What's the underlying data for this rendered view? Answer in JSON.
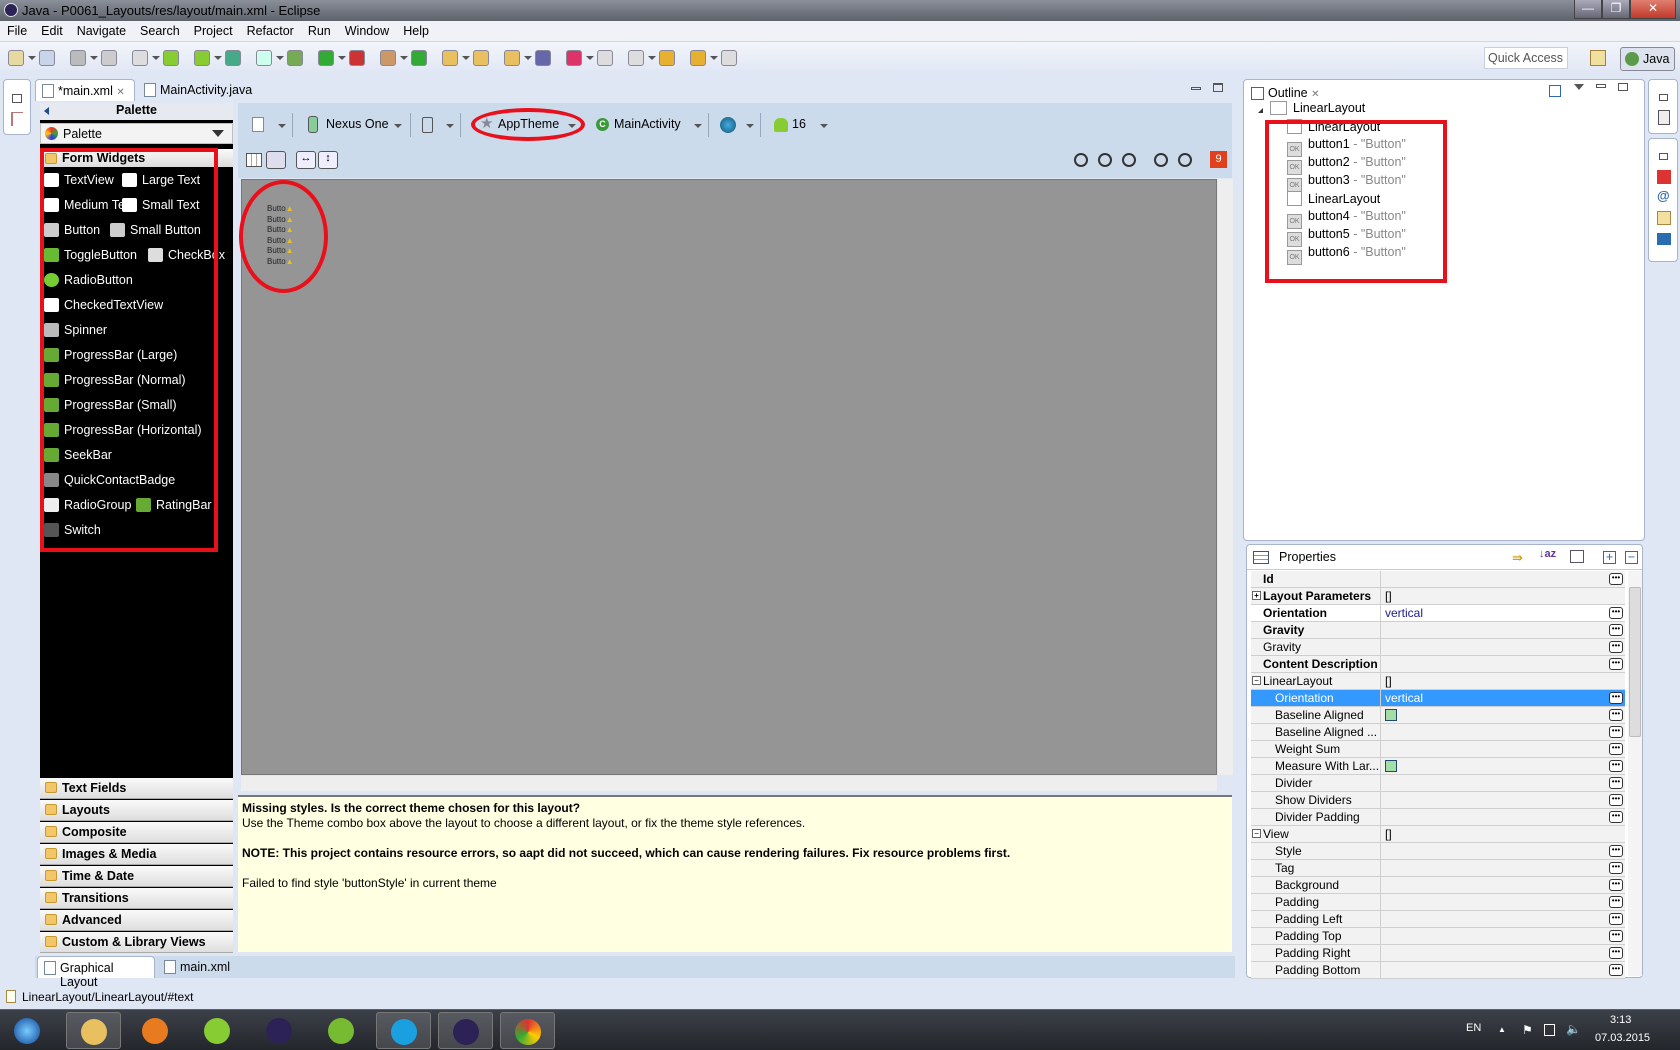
{
  "window": {
    "title": "Java - P0061_Layouts/res/layout/main.xml - Eclipse",
    "minimize": "—",
    "maximize": "❐",
    "close": "✕"
  },
  "menu": [
    "File",
    "Edit",
    "Navigate",
    "Search",
    "Project",
    "Refactor",
    "Run",
    "Window",
    "Help"
  ],
  "toolbar": {
    "quick_access": "Quick Access",
    "perspective": "Java"
  },
  "editor": {
    "tabs": [
      {
        "label": "*main.xml",
        "close": "✕"
      },
      {
        "label": "MainActivity.java"
      }
    ],
    "bottom_tabs": [
      "Graphical Layout",
      "main.xml"
    ]
  },
  "palette": {
    "header": "Palette",
    "dropdown": "Palette",
    "open_category": "Form Widgets",
    "items": [
      [
        {
          "label": "TextView",
          "icon": "ab"
        },
        {
          "label": "Large Text",
          "icon": "ab"
        }
      ],
      [
        {
          "label": "Medium Text",
          "icon": "ab"
        },
        {
          "label": "Small Text",
          "icon": "ab"
        }
      ],
      [
        {
          "label": "Button",
          "icon": "ok"
        },
        {
          "label": "Small Button",
          "icon": "ok"
        }
      ],
      [
        {
          "label": "ToggleButton",
          "icon": "toggle"
        },
        {
          "label": "CheckBox",
          "icon": "check"
        }
      ],
      [
        {
          "label": "RadioButton",
          "icon": "radio"
        }
      ],
      [
        {
          "label": "CheckedTextView",
          "icon": "checked-text"
        }
      ],
      [
        {
          "label": "Spinner",
          "icon": "spinner"
        }
      ],
      [
        {
          "label": "ProgressBar (Large)",
          "icon": "progress"
        }
      ],
      [
        {
          "label": "ProgressBar (Normal)",
          "icon": "progress"
        }
      ],
      [
        {
          "label": "ProgressBar (Small)",
          "icon": "progress"
        }
      ],
      [
        {
          "label": "ProgressBar (Horizontal)",
          "icon": "progress"
        }
      ],
      [
        {
          "label": "SeekBar",
          "icon": "seekbar"
        }
      ],
      [
        {
          "label": "QuickContactBadge",
          "icon": "badge"
        }
      ],
      [
        {
          "label": "RadioGroup",
          "icon": "radiogroup"
        },
        {
          "label": "RatingBar",
          "icon": "star"
        }
      ],
      [
        {
          "label": "Switch",
          "icon": "switch"
        }
      ]
    ],
    "categories": [
      "Text Fields",
      "Layouts",
      "Composite",
      "Images & Media",
      "Time & Date",
      "Transitions",
      "Advanced",
      "Custom & Library Views"
    ]
  },
  "canvas_toolbar": {
    "device": "Nexus One",
    "theme": "AppTheme",
    "activity": "MainActivity",
    "api": "16",
    "error_count": "9"
  },
  "canvas": {
    "buttons": [
      "Butto",
      "Butto",
      "Butto",
      "Butto",
      "Butto",
      "Butto"
    ]
  },
  "error_panel": {
    "title": "Missing styles. Is the correct theme chosen for this layout?",
    "line1": "Use the Theme combo box above the layout to choose a different layout, or fix the theme style references.",
    "note": "NOTE: This project contains resource errors, so aapt did not succeed, which can cause rendering failures. Fix resource problems first.",
    "failed": "Failed to find style 'buttonStyle' in current theme"
  },
  "outline": {
    "title": "Outline",
    "root": "LinearLayout",
    "items": [
      {
        "name": "LinearLayout",
        "text": ""
      },
      {
        "name": "button1",
        "text": " - \"Button\""
      },
      {
        "name": "button2",
        "text": " - \"Button\""
      },
      {
        "name": "button3",
        "text": " - \"Button\""
      },
      {
        "name": "LinearLayout",
        "text": ""
      },
      {
        "name": "button4",
        "text": " - \"Button\""
      },
      {
        "name": "button5",
        "text": " - \"Button\""
      },
      {
        "name": "button6",
        "text": " - \"Button\""
      }
    ]
  },
  "properties": {
    "title": "Properties",
    "rows": [
      {
        "name": "Id",
        "value": "",
        "bold": true,
        "indent": 0,
        "btn": true
      },
      {
        "name": "Layout Parameters",
        "value": "[]",
        "bold": true,
        "indent": 0,
        "expander": "+"
      },
      {
        "name": "Orientation",
        "value": "vertical",
        "bold": true,
        "indent": 0,
        "btn": true,
        "white": true
      },
      {
        "name": "Gravity",
        "value": "",
        "bold": true,
        "indent": 0,
        "btn": true
      },
      {
        "name": "Gravity",
        "value": "",
        "indent": 0,
        "btn": true
      },
      {
        "name": "Content Description",
        "value": "",
        "bold": true,
        "indent": 0,
        "btn": true
      },
      {
        "name": "LinearLayout",
        "value": "[]",
        "indent": 0,
        "expander": "−"
      },
      {
        "name": "Orientation",
        "value": "vertical",
        "indent": 1,
        "btn": true,
        "selected": true
      },
      {
        "name": "Baseline Aligned",
        "value": "",
        "indent": 1,
        "btn": true,
        "checkbox": true
      },
      {
        "name": "Baseline Aligned ...",
        "value": "",
        "indent": 1,
        "btn": true
      },
      {
        "name": "Weight Sum",
        "value": "",
        "indent": 1,
        "btn": true
      },
      {
        "name": "Measure With Lar...",
        "value": "",
        "indent": 1,
        "btn": true,
        "checkbox": true
      },
      {
        "name": "Divider",
        "value": "",
        "indent": 1,
        "btn": true
      },
      {
        "name": "Show Dividers",
        "value": "",
        "indent": 1,
        "btn": true
      },
      {
        "name": "Divider Padding",
        "value": "",
        "indent": 1,
        "btn": true
      },
      {
        "name": "View",
        "value": "[]",
        "indent": 0,
        "expander": "−"
      },
      {
        "name": "Style",
        "value": "",
        "indent": 1,
        "btn": true
      },
      {
        "name": "Tag",
        "value": "",
        "indent": 1,
        "btn": true
      },
      {
        "name": "Background",
        "value": "",
        "indent": 1,
        "btn": true
      },
      {
        "name": "Padding",
        "value": "",
        "indent": 1,
        "btn": true
      },
      {
        "name": "Padding Left",
        "value": "",
        "indent": 1,
        "btn": true
      },
      {
        "name": "Padding Top",
        "value": "",
        "indent": 1,
        "btn": true
      },
      {
        "name": "Padding Right",
        "value": "",
        "indent": 1,
        "btn": true
      },
      {
        "name": "Padding Bottom",
        "value": "",
        "indent": 1,
        "btn": true
      }
    ]
  },
  "status": {
    "path": "LinearLayout/LinearLayout/#text"
  },
  "taskbar": {
    "apps": [
      "start",
      "explorer",
      "media-player",
      "android-studio",
      "eclipse",
      "utorrent",
      "skype",
      "eclipse-active",
      "chrome"
    ],
    "lang": "EN",
    "time": "3:13",
    "date": "07.03.2015"
  },
  "colors": {
    "annotation_red": "#e8101a",
    "selection": "#3399ff",
    "error_bg": "#ffffe1",
    "error_badge": "#e0401c"
  }
}
